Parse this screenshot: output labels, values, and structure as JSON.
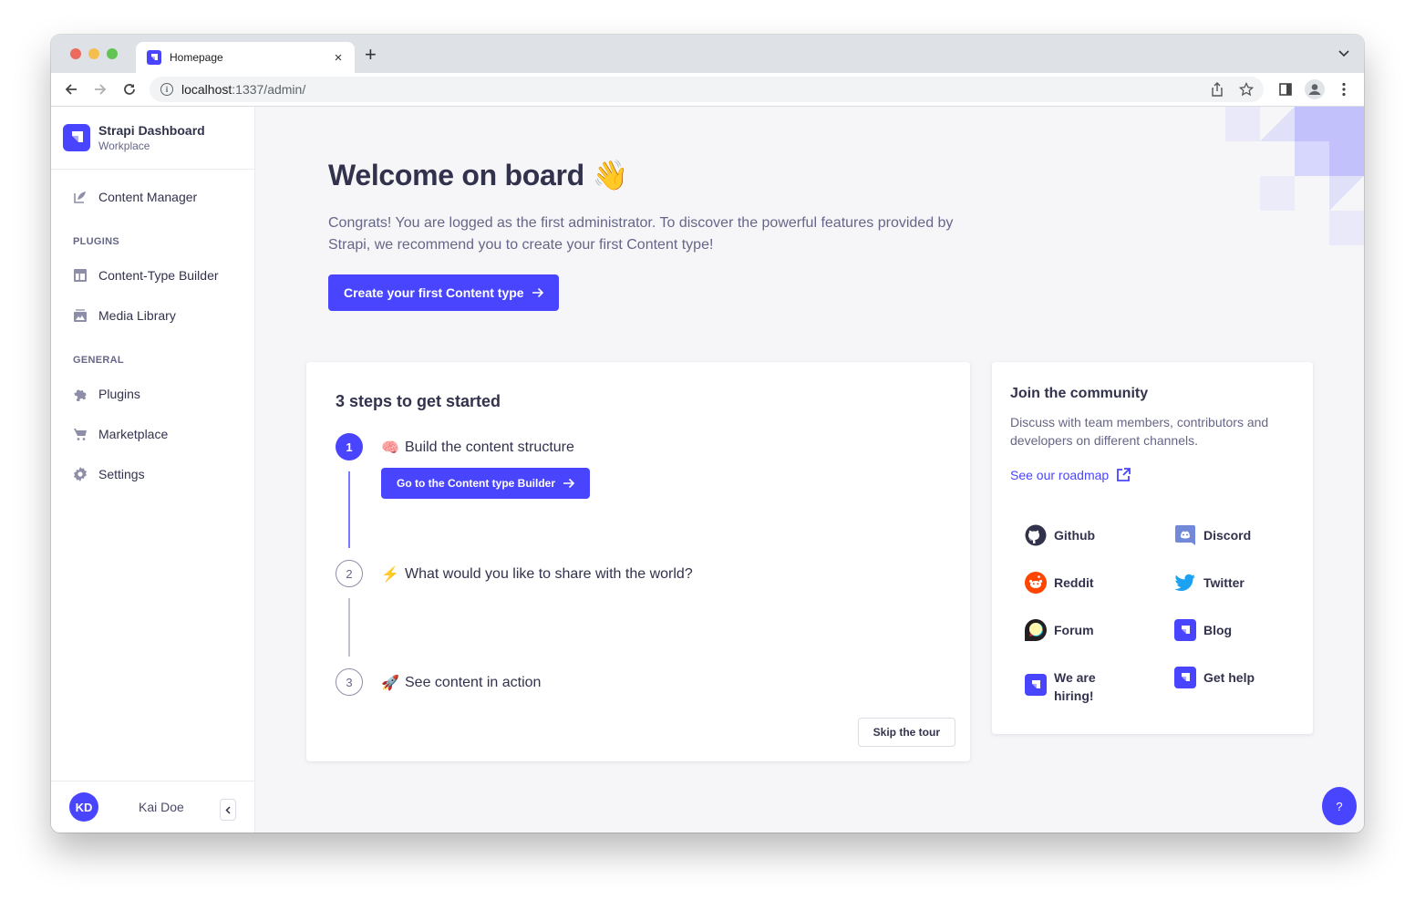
{
  "browser": {
    "tab_title": "Homepage",
    "url_host": "localhost",
    "url_path": ":1337/admin/",
    "new_tab": "+",
    "close": "×"
  },
  "brand": {
    "name": "Strapi Dashboard",
    "subtitle": "Workplace",
    "color": "#4945ff"
  },
  "sidebar": {
    "items": [
      {
        "label": "Content Manager",
        "icon": "feather-icon"
      },
      {
        "label": "Content-Type Builder",
        "icon": "layout-icon"
      },
      {
        "label": "Media Library",
        "icon": "image-icon"
      },
      {
        "label": "Plugins",
        "icon": "puzzle-icon"
      },
      {
        "label": "Marketplace",
        "icon": "cart-icon"
      },
      {
        "label": "Settings",
        "icon": "gear-icon"
      }
    ],
    "sections": {
      "plugins": "PLUGINS",
      "general": "GENERAL"
    },
    "user": {
      "initials": "KD",
      "name": "Kai Doe"
    }
  },
  "welcome": {
    "title": "Welcome on board",
    "emoji": "👋",
    "text": "Congrats! You are logged as the first administrator. To discover the powerful features provided by Strapi, we recommend you to create your first Content type!",
    "cta": "Create your first Content type"
  },
  "steps": {
    "title": "3 steps to get started",
    "items": [
      {
        "number": "1",
        "emoji": "🧠",
        "label": "Build the content structure",
        "active": true,
        "button": "Go to the Content type Builder"
      },
      {
        "number": "2",
        "emoji": "⚡",
        "label": "What would you like to share with the world?",
        "active": false
      },
      {
        "number": "3",
        "emoji": "🚀",
        "label": "See content in action",
        "active": false
      }
    ],
    "skip": "Skip the tour"
  },
  "community": {
    "title": "Join the community",
    "text": "Discuss with team members, contributors and developers on different channels.",
    "roadmap": "See our roadmap",
    "links": [
      {
        "label": "Github",
        "icon": "github-icon"
      },
      {
        "label": "Discord",
        "icon": "discord-icon"
      },
      {
        "label": "Reddit",
        "icon": "reddit-icon"
      },
      {
        "label": "Twitter",
        "icon": "twitter-icon"
      },
      {
        "label": "Forum",
        "icon": "forum-icon"
      },
      {
        "label": "Blog",
        "icon": "strapi-icon"
      },
      {
        "label": "We are hiring!",
        "icon": "strapi-icon"
      },
      {
        "label": "Get help",
        "icon": "strapi-icon"
      }
    ]
  },
  "help": {
    "label": "?"
  }
}
